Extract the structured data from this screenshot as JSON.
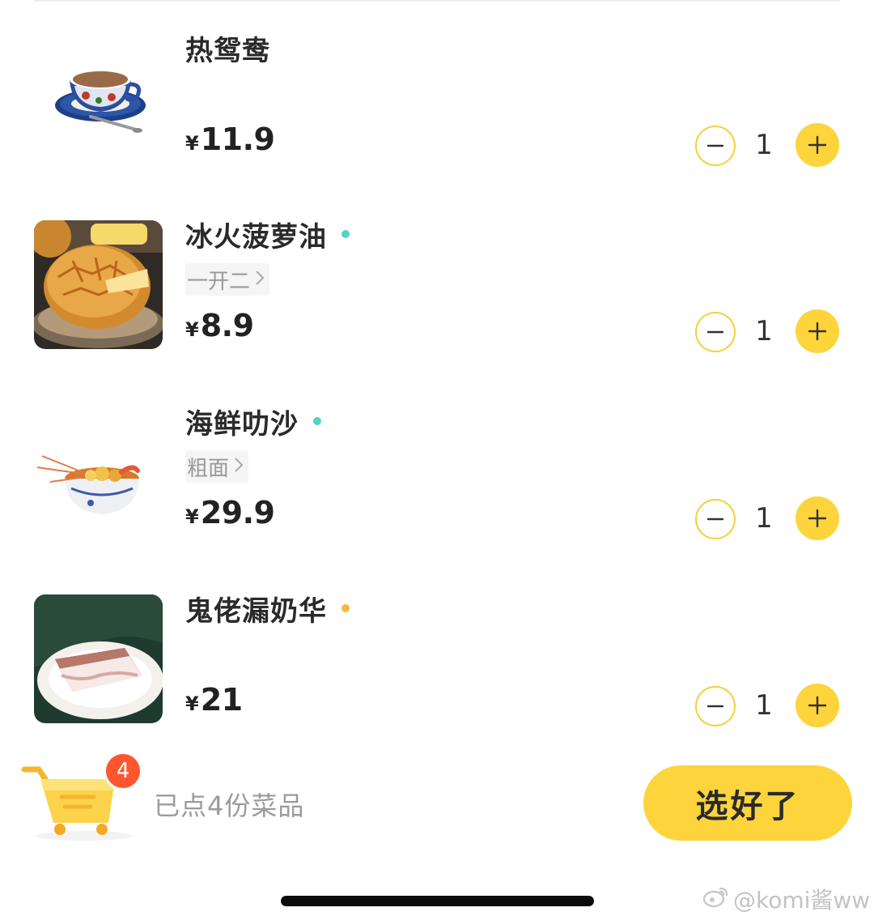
{
  "items": [
    {
      "name": "热鸳鸯",
      "currency": "¥",
      "price": "11.9",
      "quantity": "1",
      "spec": "",
      "dot_color": "",
      "image": "milk-tea-cup-image"
    },
    {
      "name": "冰火菠萝油",
      "currency": "¥",
      "price": "8.9",
      "quantity": "1",
      "spec": "一开二",
      "dot_color": "#52d4c8",
      "image": "pineapple-bun-image"
    },
    {
      "name": "海鲜叻沙",
      "currency": "¥",
      "price": "29.9",
      "quantity": "1",
      "spec": "粗面",
      "dot_color": "#52d4c8",
      "image": "laksa-bowl-image"
    },
    {
      "name": "鬼佬漏奶华",
      "currency": "¥",
      "price": "21",
      "quantity": "1",
      "spec": "",
      "dot_color": "#f5b93b",
      "image": "toast-dessert-image"
    }
  ],
  "cart": {
    "badge_count": "4",
    "summary": "已点4份菜品",
    "confirm_label": "选好了"
  },
  "watermark": "@komi酱ww",
  "colors": {
    "accent_yellow": "#fdd43c",
    "badge_red": "#ff5630",
    "dot_teal": "#52d4c8",
    "dot_orange": "#f5b93b"
  }
}
